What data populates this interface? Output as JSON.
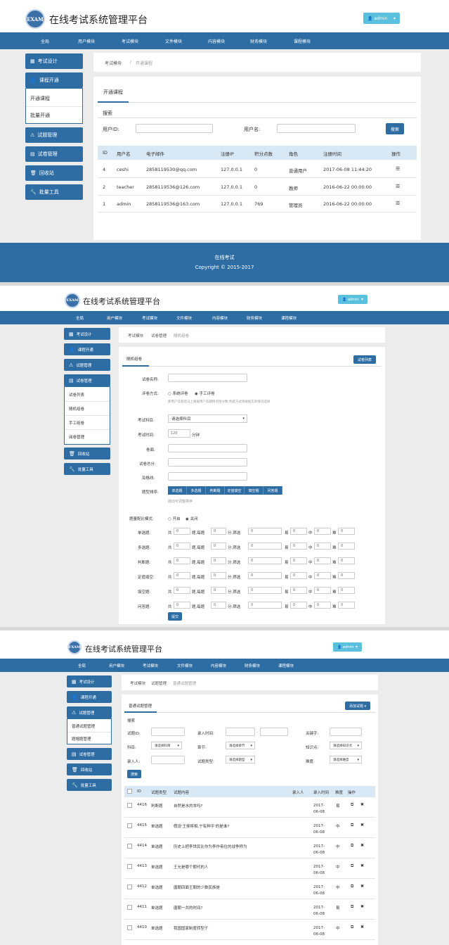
{
  "app": {
    "logo_text": "EXAM",
    "title": "在线考试系统管理平台",
    "user": "admin",
    "caret": "▾"
  },
  "nav": [
    "全局",
    "用户模块",
    "考试模块",
    "文件模块",
    "内容模块",
    "财务模块",
    "课程模块"
  ],
  "sidebar": {
    "exam_design": "考试设计",
    "course_open": "课程开通",
    "question_mgmt": "试题管理",
    "paper_mgmt": "试卷管理",
    "recycle": "回收站",
    "bulk_tools": "批量工具"
  },
  "panel1": {
    "sub_items": [
      "开通课程",
      "批量开通"
    ],
    "breadcrumb": [
      "考试模块",
      "开通课程"
    ],
    "tab": "开通课程",
    "search_label": "搜索",
    "userid_label": "用户ID:",
    "username_label": "用户名:",
    "search_button": "搜索",
    "headers": [
      "ID",
      "用户名",
      "电子邮件",
      "注册IP",
      "积分点数",
      "角色",
      "注册时间",
      "操作"
    ],
    "rows": [
      [
        "4",
        "ceshi",
        "2858119530@qq.com",
        "127.0.0.1",
        "0",
        "普通用户",
        "2017-06-08 11:44:20"
      ],
      [
        "2",
        "teacher",
        "2858119536@126.com",
        "127.0.0.1",
        "0",
        "教师",
        "2016-06-22 00:00:00"
      ],
      [
        "1",
        "admin",
        "2858119536@163.com",
        "127.0.0.1",
        "769",
        "管理员",
        "2016-06-22 00:00:00"
      ]
    ]
  },
  "footer": {
    "line1": "在线考试",
    "line2": "Copyright © 2015-2017"
  },
  "panel2": {
    "sub_items": [
      "试卷列表",
      "随机组卷",
      "手工组卷",
      "阅卷管理"
    ],
    "breadcrumb": [
      "考试模块",
      "试卷管理",
      "随机组卷"
    ],
    "tab": "随机组卷",
    "top_button": "试卷列表",
    "labels": {
      "name": "试卷名称:",
      "scoring": "评卷方式:",
      "subject": "考试科目:",
      "duration": "考试时间:",
      "total": "卷面:",
      "pass": "试卷总分:",
      "passline": "及格线:",
      "order": "题型排序:",
      "config": "题量配比模式:"
    },
    "scoring_options": [
      "系统评卷",
      "手工评卷"
    ],
    "scoring_note": "即用户答题后马上根据用户答题情况给分数,判题方式请根据实际情况选择",
    "subject_value": "请选择科目",
    "duration_value": "120",
    "duration_unit": "分钟",
    "order_tags": [
      "单选题",
      "多选题",
      "判断题",
      "定值填空",
      "填空题",
      "问答题"
    ],
    "order_hint": "拖动可调整排序",
    "config_options": [
      "开启",
      "关闭"
    ],
    "qtypes": [
      "单选题:",
      "多选题:",
      "判断题:",
      "定值填空:",
      "填空题:",
      "问答题:"
    ],
    "row_words": [
      "共",
      "题,每题",
      "分,筛选",
      "易",
      "中",
      "难"
    ],
    "row_value": "0",
    "submit": "提交"
  },
  "panel3": {
    "sub_items": [
      "普通试题管理",
      "题帽题管理"
    ],
    "breadcrumb": [
      "考试模块",
      "试题管理",
      "普通试题管理"
    ],
    "tab": "普通试题管理",
    "top_button": "添加试题 ▾",
    "search_label": "搜索",
    "filters": {
      "qid": "试题ID:",
      "entry_time": "录入时间:",
      "keyword": "关键字:",
      "subject": "科目:",
      "subject_value": "请选择科目",
      "chapter": "章节:",
      "chapter_value": "请选择章节",
      "point": "知识点:",
      "point_value": "请选择知识点",
      "entry_person": "录入人:",
      "qtype": "试题类型:",
      "qtype_value": "请选择题型",
      "difficulty": "难度:",
      "difficulty_value": "请选择难度"
    },
    "search_button": "搜索",
    "headers": [
      "ID",
      "试题类型",
      "试题内容",
      "录入人",
      "录入时间",
      "难度",
      "操作"
    ],
    "rows": [
      [
        "4416",
        "判断题",
        "自然是水的本吗?",
        "",
        "2017-06-08",
        "易"
      ],
      [
        "4415",
        "单选题",
        "假设'王侯将相,宁有种乎'的是谁?",
        "",
        "2017-06-08",
        "中"
      ],
      [
        "4414",
        "单选题",
        "历史上把李世民比作为李作帝位的战争称为",
        "",
        "2017-06-08",
        "中"
      ],
      [
        "4413",
        "单选题",
        "王允是哪个朝代的人",
        "",
        "2017-06-08",
        "中"
      ],
      [
        "4412",
        "单选题",
        "唐朝四面王朝的少数民族是",
        "",
        "2017-06-08",
        "中"
      ],
      [
        "4411",
        "单选题",
        "唐朝一共的时间?",
        "",
        "2017-06-08",
        "易"
      ],
      [
        "4410",
        "单选题",
        "我国国家制度转型于",
        "",
        "2017-06-08",
        "中"
      ]
    ],
    "op_edit": "⧉",
    "op_delete": "✖"
  },
  "colors": {
    "primary": "#2e6da4",
    "info": "#5bc0de",
    "table_head": "#d9e8f5"
  }
}
